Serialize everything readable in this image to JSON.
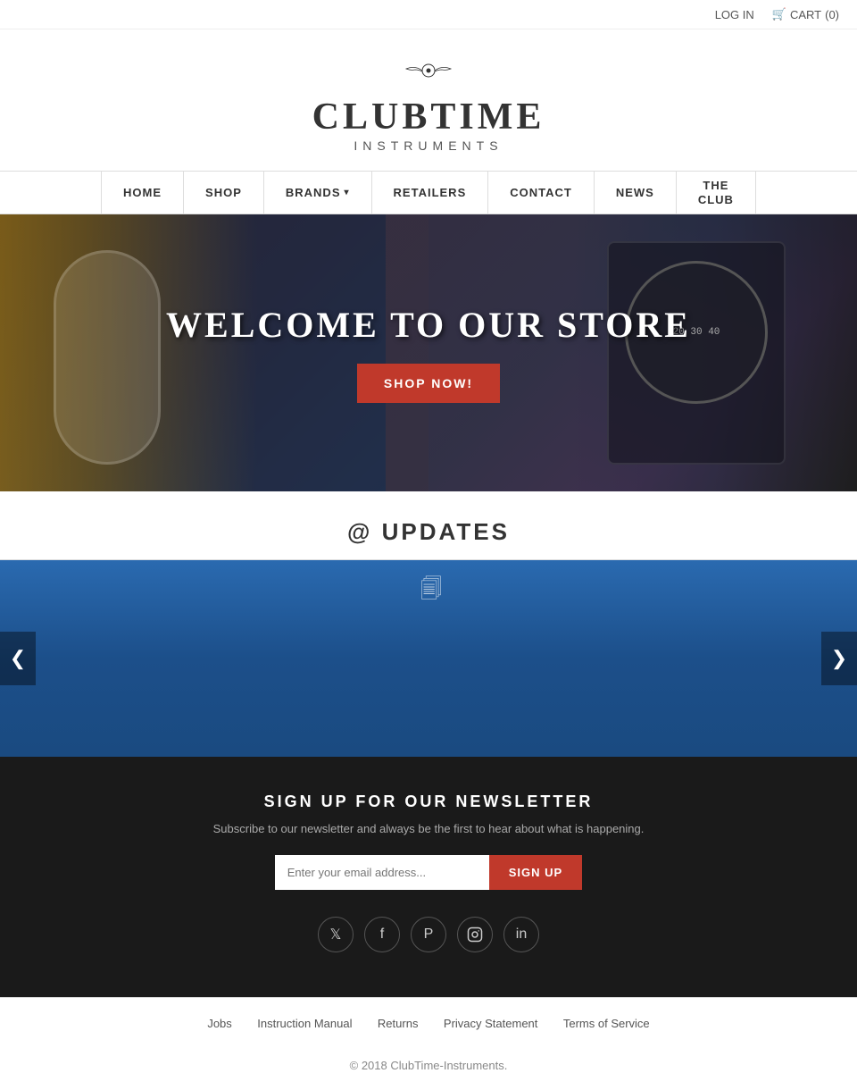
{
  "topbar": {
    "login_label": "LOG IN",
    "cart_label": "CART",
    "cart_count": "(0)"
  },
  "logo": {
    "brand_name": "CLUBTIME",
    "brand_sub": "INSTRUMENTS"
  },
  "nav": {
    "items": [
      {
        "id": "home",
        "label": "HOME",
        "has_dropdown": false
      },
      {
        "id": "shop",
        "label": "SHOP",
        "has_dropdown": false
      },
      {
        "id": "brands",
        "label": "BRANDS",
        "has_dropdown": true
      },
      {
        "id": "retailers",
        "label": "RETAILERS",
        "has_dropdown": false
      },
      {
        "id": "contact",
        "label": "CONTACT",
        "has_dropdown": false
      },
      {
        "id": "news",
        "label": "NEWS",
        "has_dropdown": false
      },
      {
        "id": "the-club",
        "label_line1": "THE",
        "label_line2": "CLUB",
        "has_dropdown": false
      }
    ]
  },
  "hero": {
    "title": "WELCOME TO OUR STORE",
    "button_label": "SHOP NOW!"
  },
  "updates": {
    "title": "@ UPDATES"
  },
  "carousel": {
    "prev_arrow": "❮",
    "next_arrow": "❯"
  },
  "newsletter": {
    "title": "SIGN UP FOR OUR NEWSLETTER",
    "subtitle": "Subscribe to our newsletter and always be the first to hear about what is happening.",
    "input_placeholder": "Enter your email address...",
    "button_label": "SIGN UP"
  },
  "social": {
    "icons": [
      {
        "id": "twitter",
        "symbol": "🐦",
        "label": "Twitter"
      },
      {
        "id": "facebook",
        "symbol": "f",
        "label": "Facebook"
      },
      {
        "id": "pinterest",
        "symbol": "P",
        "label": "Pinterest"
      },
      {
        "id": "instagram",
        "symbol": "📷",
        "label": "Instagram"
      },
      {
        "id": "linkedin",
        "symbol": "in",
        "label": "LinkedIn"
      }
    ]
  },
  "footer": {
    "links": [
      {
        "id": "jobs",
        "label": "Jobs"
      },
      {
        "id": "instruction-manual",
        "label": "Instruction Manual"
      },
      {
        "id": "returns",
        "label": "Returns"
      },
      {
        "id": "privacy",
        "label": "Privacy Statement"
      },
      {
        "id": "terms",
        "label": "Terms of Service"
      }
    ],
    "copyright": "© 2018 ClubTime-Instruments."
  }
}
